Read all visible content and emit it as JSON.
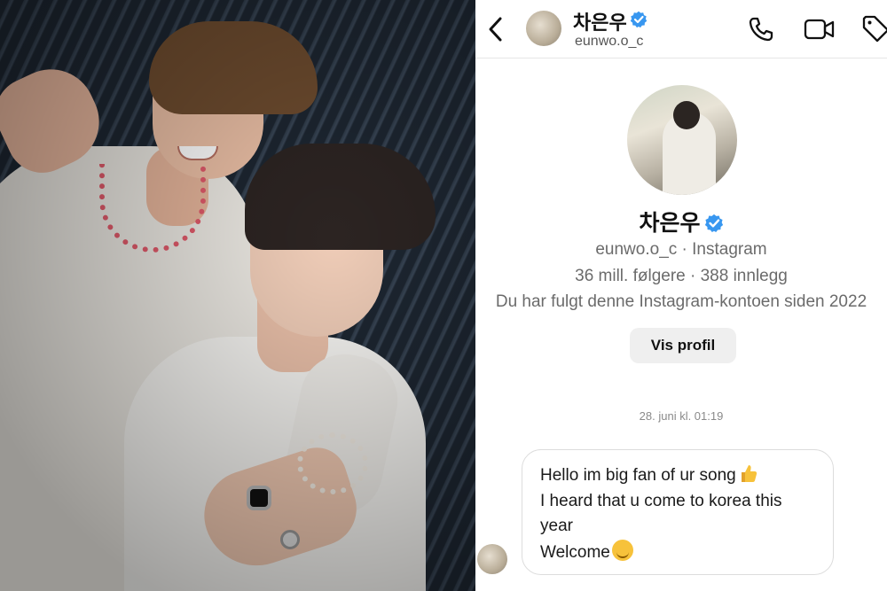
{
  "header": {
    "name": "차은우",
    "handle": "eunwo.o_c",
    "colors": {
      "verified": "#3897f0",
      "icon": "#111111"
    }
  },
  "profile": {
    "name": "차은우",
    "handle_line": "eunwo.o_c · Instagram",
    "stats_line": "36 mill. følgere · 388 innlegg",
    "follow_line": "Du har fulgt denne Instagram-kontoen siden 2022",
    "view_profile_label": "Vis profil"
  },
  "conversation": {
    "timestamp": "28. juni kl. 01:19",
    "message": {
      "line1": "Hello im big fan of ur song",
      "line2": "I heard that u come to korea this year",
      "line3": "Welcome",
      "emoji1": "thumbs-up-icon",
      "emoji2": "hugging-face-icon"
    }
  },
  "icons": {
    "back": "chevron-left-icon",
    "call": "phone-icon",
    "video": "video-camera-icon",
    "tag": "tag-icon"
  }
}
